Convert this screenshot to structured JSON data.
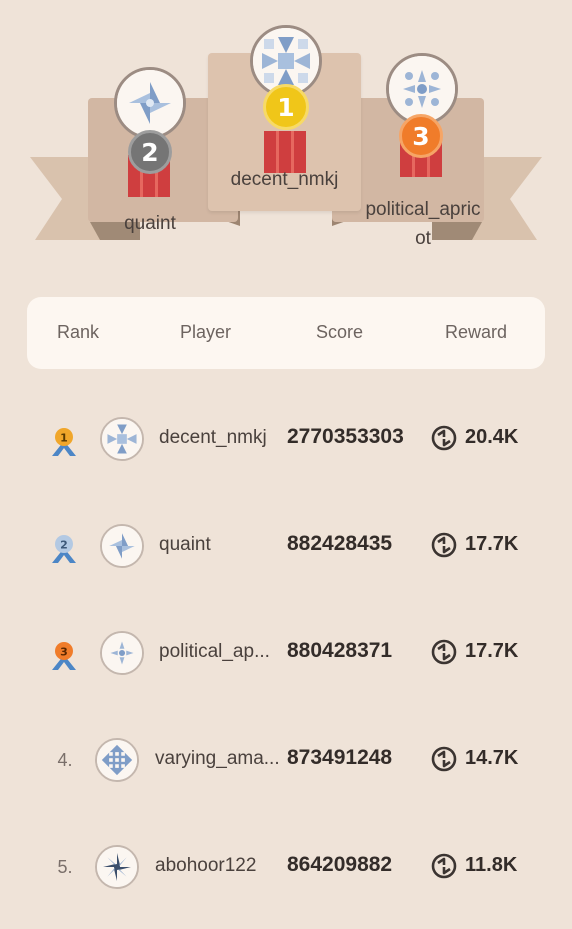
{
  "podium": [
    {
      "place": "1",
      "name": "decent_nmkj",
      "avatar_icon": "quilt-avatar-icon"
    },
    {
      "place": "2",
      "name": "quaint",
      "avatar_icon": "pinwheel-avatar-icon"
    },
    {
      "place": "3",
      "name": "political_apricot",
      "name_line1": "political_apric",
      "name_line2": "ot",
      "avatar_icon": "snowflake-avatar-icon"
    }
  ],
  "header": {
    "rank": "Rank",
    "player": "Player",
    "score": "Score",
    "reward": "Reward"
  },
  "rows": [
    {
      "rank": "1",
      "rank_icon": "gold-medal-icon",
      "name": "decent_nmkj",
      "score": "2770353303",
      "reward": "20.4K"
    },
    {
      "rank": "2",
      "rank_icon": "silver-medal-icon",
      "name": "quaint",
      "score": "882428435",
      "reward": "17.7K"
    },
    {
      "rank": "3",
      "rank_icon": "bronze-medal-icon",
      "name": "political_ap...",
      "score": "880428371",
      "reward": "17.7K"
    },
    {
      "rank": "4.",
      "name": "varying_ama...",
      "score": "873491248",
      "reward": "14.7K"
    },
    {
      "rank": "5.",
      "name": "abohoor122",
      "score": "864209882",
      "reward": "11.8K"
    }
  ],
  "colors": {
    "background": "#efe3d8",
    "gold": "#f0c619",
    "silver": "#757575",
    "bronze": "#f07c2a",
    "ribbon": "#cf3e3f",
    "avatar_blue": "#7f9dc7"
  }
}
